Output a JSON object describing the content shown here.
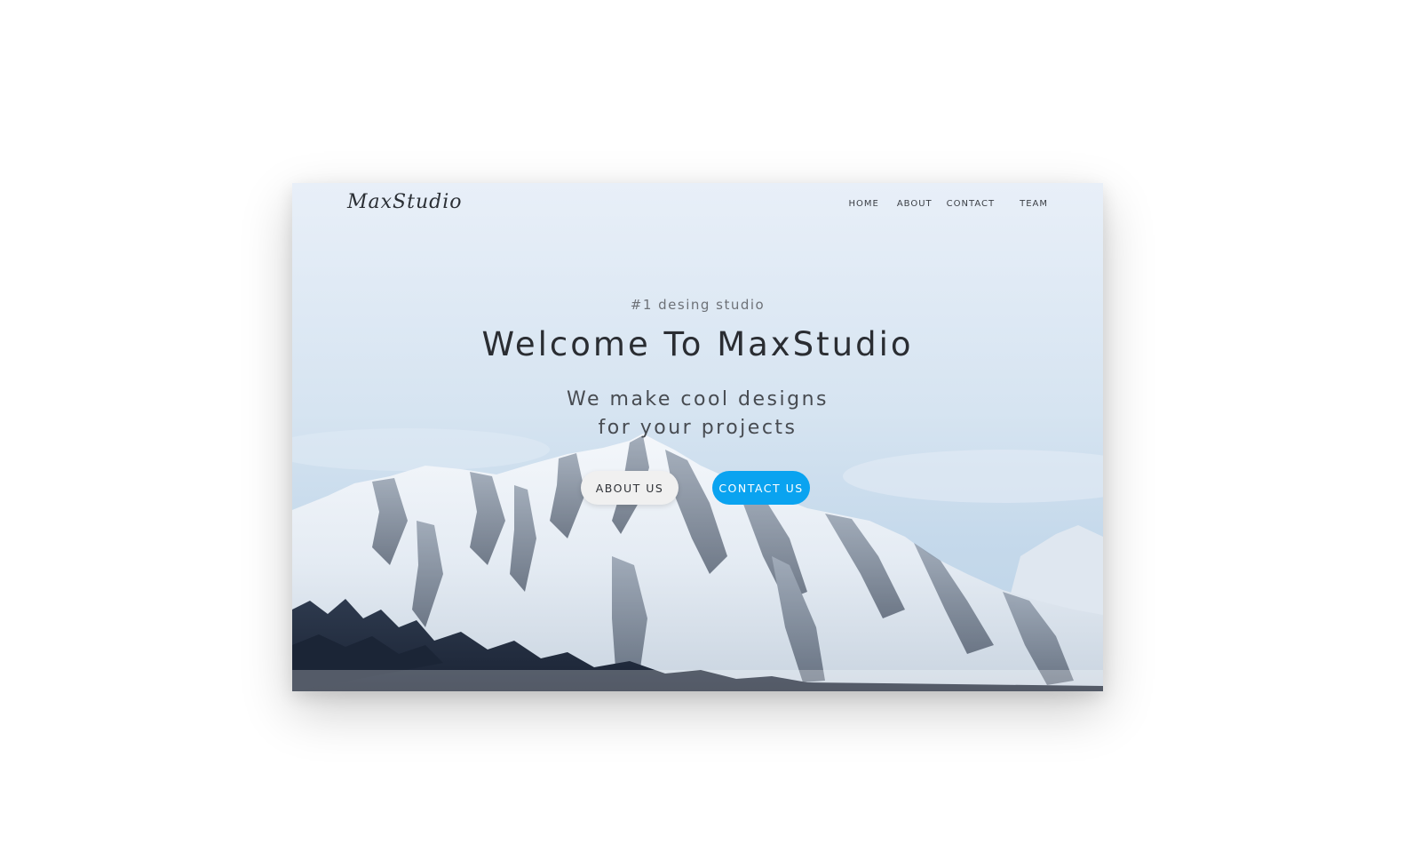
{
  "brand": {
    "logo_text": "MaxStudio"
  },
  "nav": {
    "items": [
      {
        "label": "HOME"
      },
      {
        "label": "ABOUT"
      },
      {
        "label": "CONTACT"
      },
      {
        "label": "TEAM"
      }
    ]
  },
  "hero": {
    "tagline": "#1 desing studio",
    "headline": "Welcome To MaxStudio",
    "subline_1": "We make cool designs",
    "subline_2": "for your projects",
    "primary_button": "ABOUT US",
    "secondary_button": "CONTACT US",
    "background": "snowy-mountain-photo"
  },
  "colors": {
    "accent": "#0aa3f0",
    "sky": "#dbe7f3",
    "text_dark": "#2a2d32"
  }
}
